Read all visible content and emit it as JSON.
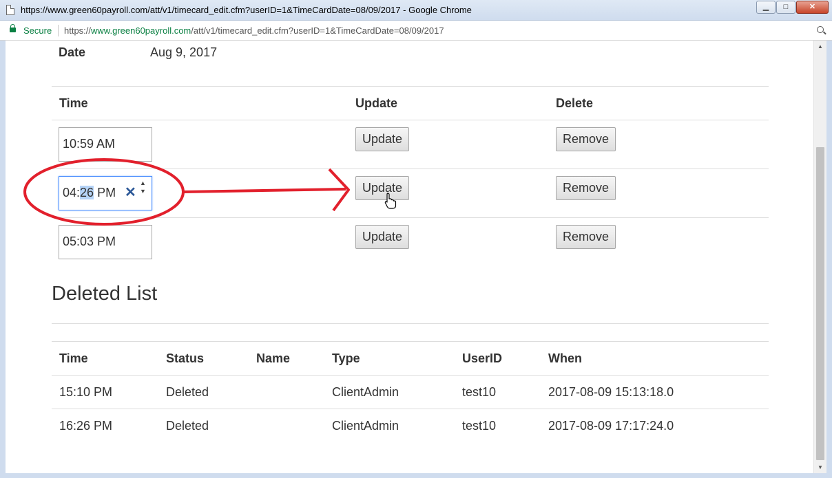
{
  "window": {
    "title": "https://www.green60payroll.com/att/v1/timecard_edit.cfm?userID=1&TimeCardDate=08/09/2017 - Google Chrome",
    "minimize_glyph": "▁",
    "maximize_glyph": "□",
    "close_glyph": "✕"
  },
  "address_bar": {
    "secure_label": "Secure",
    "url_scheme": "https://",
    "url_host": "www.green60payroll.com",
    "url_path": "/att/v1/timecard_edit.cfm?userID=1&TimeCardDate=08/09/2017"
  },
  "date": {
    "label": "Date",
    "value": "Aug 9, 2017"
  },
  "time_table": {
    "headers": {
      "time": "Time",
      "update": "Update",
      "delete": "Delete"
    },
    "rows": [
      {
        "time": "10:59 AM",
        "update_label": "Update",
        "remove_label": "Remove"
      },
      {
        "time_hour": "04",
        "time_sep": ":",
        "time_minute": "26",
        "time_ampm": "PM",
        "update_label": "Update",
        "remove_label": "Remove"
      },
      {
        "time": "05:03 PM",
        "update_label": "Update",
        "remove_label": "Remove"
      }
    ]
  },
  "deleted_list": {
    "title": "Deleted List",
    "headers": {
      "time": "Time",
      "status": "Status",
      "name": "Name",
      "type": "Type",
      "userid": "UserID",
      "when": "When"
    },
    "rows": [
      {
        "time": "15:10 PM",
        "status": "Deleted",
        "name": "",
        "type": "ClientAdmin",
        "userid": "test10",
        "when": "2017-08-09 15:13:18.0"
      },
      {
        "time": "16:26 PM",
        "status": "Deleted",
        "name": "",
        "type": "ClientAdmin",
        "userid": "test10",
        "when": "2017-08-09 17:17:24.0"
      }
    ]
  },
  "icons": {
    "clear": "✕",
    "spin_up": "▲",
    "spin_down": "▼",
    "scroll_up": "▲",
    "scroll_down": "▼"
  },
  "colors": {
    "annotation_red": "#e2202c",
    "secure_green": "#0b8043",
    "focus_blue": "#4d90fe",
    "selection": "#b6d4f7"
  }
}
